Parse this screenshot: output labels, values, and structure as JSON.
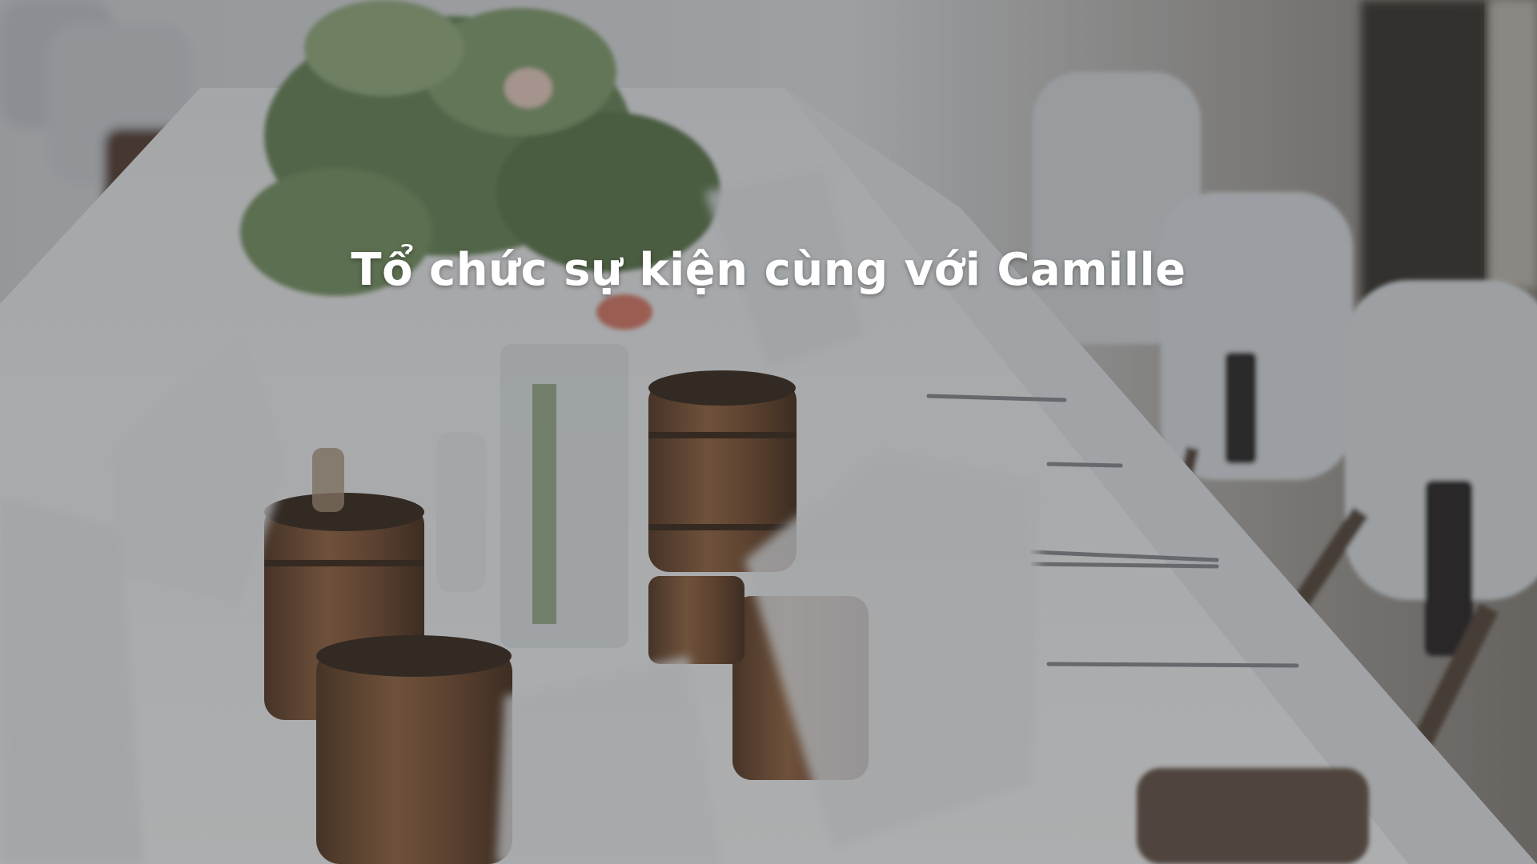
{
  "hero": {
    "title": "Tổ chức sự kiện cùng với Camille",
    "background": {
      "icon": "event-table-photo",
      "overlay_color": "#282a2d"
    }
  }
}
